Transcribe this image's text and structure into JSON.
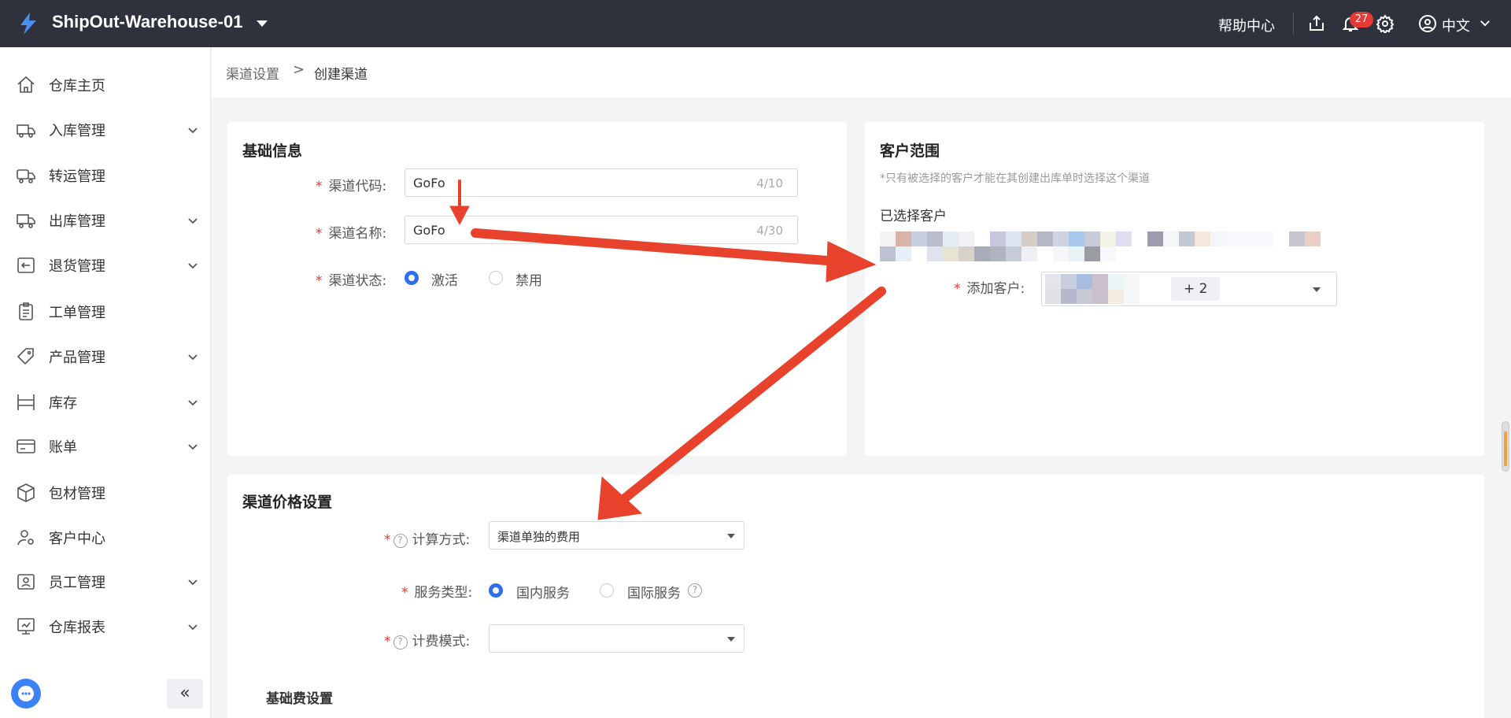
{
  "header": {
    "app_title": "ShipOut-Warehouse-01",
    "help": "帮助中心",
    "notification_count": "27",
    "language": "中文"
  },
  "sidebar": {
    "items": [
      {
        "label": "仓库主页",
        "icon": "home-icon",
        "expandable": false
      },
      {
        "label": "入库管理",
        "icon": "truck-inbound-icon",
        "expandable": true
      },
      {
        "label": "转运管理",
        "icon": "truck-transfer-icon",
        "expandable": false
      },
      {
        "label": "出库管理",
        "icon": "truck-outbound-icon",
        "expandable": true
      },
      {
        "label": "退货管理",
        "icon": "return-icon",
        "expandable": true
      },
      {
        "label": "工单管理",
        "icon": "clipboard-icon",
        "expandable": false
      },
      {
        "label": "产品管理",
        "icon": "tag-icon",
        "expandable": true
      },
      {
        "label": "库存",
        "icon": "shelf-icon",
        "expandable": true
      },
      {
        "label": "账单",
        "icon": "card-icon",
        "expandable": true
      },
      {
        "label": "包材管理",
        "icon": "box-icon",
        "expandable": false
      },
      {
        "label": "客户中心",
        "icon": "user-gear-icon",
        "expandable": false
      },
      {
        "label": "员工管理",
        "icon": "staff-icon",
        "expandable": true
      },
      {
        "label": "仓库报表",
        "icon": "report-icon",
        "expandable": true
      }
    ],
    "collapse_label": "«"
  },
  "breadcrumb": {
    "parent": "渠道设置",
    "separator": ">",
    "current": "创建渠道"
  },
  "basic_info": {
    "title": "基础信息",
    "code_label": "渠道代码:",
    "code_value": "GoFo",
    "code_count": "4/10",
    "name_label": "渠道名称:",
    "name_value": "GoFo",
    "name_count": "4/30",
    "status_label": "渠道状态:",
    "status_active": "激活",
    "status_disabled": "禁用"
  },
  "customer_scope": {
    "title": "客户范围",
    "hint": "*只有被选择的客户才能在其创建出库单时选择这个渠道",
    "selected_label": "已选择客户",
    "add_label": "添加客户:",
    "more_tag": "+ 2"
  },
  "price_settings": {
    "title": "渠道价格设置",
    "calc_label": "计算方式:",
    "calc_value": "渠道单独的费用",
    "service_label": "服务类型:",
    "service_domestic": "国内服务",
    "service_international": "国际服务",
    "billing_label": "计费模式:",
    "billing_value": "",
    "base_fee_title": "基础费设置"
  },
  "colors": {
    "topbar": "#2f323c",
    "accent": "#2f6fed",
    "required": "#e53935",
    "arrow": "#e8412c"
  }
}
